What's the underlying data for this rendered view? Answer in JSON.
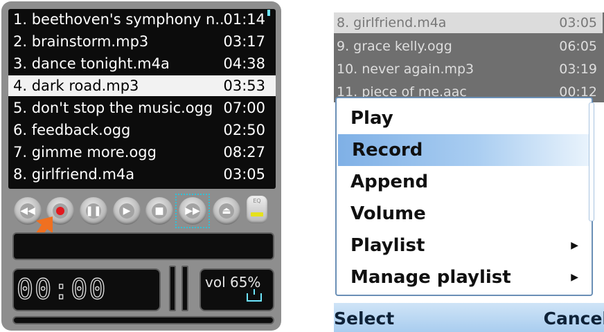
{
  "left_player": {
    "playlist": [
      {
        "name": "1. beethoven's symphony n...",
        "duration": "01:14"
      },
      {
        "name": "2. brainstorm.mp3",
        "duration": "03:17"
      },
      {
        "name": "3. dance tonight.m4a",
        "duration": "04:38"
      },
      {
        "name": "4. dark road.mp3",
        "duration": "03:53"
      },
      {
        "name": "5. don't stop the music.ogg",
        "duration": "07:00"
      },
      {
        "name": "6. feedback.ogg",
        "duration": "02:50"
      },
      {
        "name": "7. gimme more.ogg",
        "duration": "08:27"
      },
      {
        "name": "8. girlfriend.m4a",
        "duration": "03:05"
      }
    ],
    "selected_index": 3,
    "controls": [
      "rewind-icon",
      "record-icon",
      "pause-icon",
      "play-icon",
      "stop-icon",
      "fast-forward-icon",
      "eject-icon",
      "equalizer-icon"
    ],
    "eq_label": "EQ",
    "time": "00:00",
    "volume_label": "vol 65%",
    "accent_color": "#2fc2d8",
    "record_color": "#e2181e",
    "arrow_color": "#f07020"
  },
  "right_player": {
    "background_list": [
      {
        "name": "8. girlfriend.m4a",
        "duration": "03:05"
      },
      {
        "name": "9. grace kelly.ogg",
        "duration": "06:05"
      },
      {
        "name": "10. never again.mp3",
        "duration": "03:19"
      },
      {
        "name": "11. piece of me.aac",
        "duration": "00:12"
      }
    ],
    "menu_items": [
      {
        "label": "Play",
        "submenu": false
      },
      {
        "label": "Record",
        "submenu": false
      },
      {
        "label": "Append",
        "submenu": false
      },
      {
        "label": "Volume",
        "submenu": false
      },
      {
        "label": "Playlist",
        "submenu": true
      },
      {
        "label": "Manage playlist",
        "submenu": true
      }
    ],
    "highlighted_index": 1,
    "softkey_left": "Select",
    "softkey_right": "Cancel",
    "highlight_color": "#7fb0e6"
  }
}
